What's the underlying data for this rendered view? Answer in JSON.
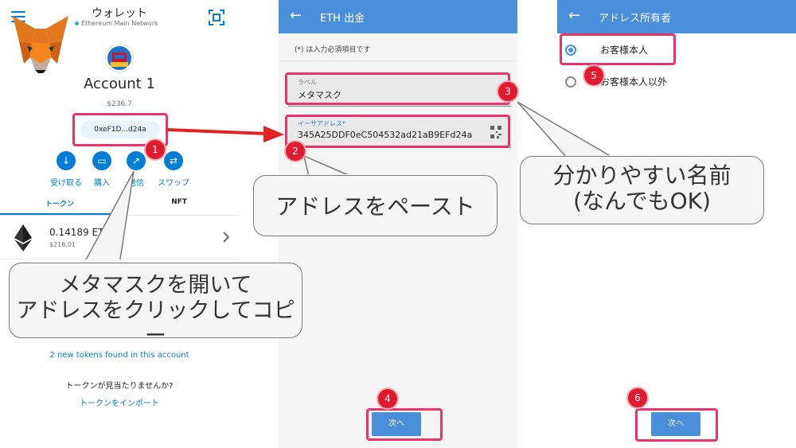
{
  "wallet": {
    "title": "ウォレット",
    "network": "Ethereum Main Network",
    "account_name": "Account 1",
    "balance": "$236.7",
    "address_short": "0xeF1D...d24a",
    "actions": [
      {
        "label": "受け取る",
        "icon": "download-icon"
      },
      {
        "label": "購入",
        "icon": "card-icon"
      },
      {
        "label": "送信",
        "icon": "send-arrow-icon"
      },
      {
        "label": "スワップ",
        "icon": "swap-icon"
      }
    ],
    "tabs": [
      "トークン",
      "NFT"
    ],
    "token": {
      "amount": "0.14189 ETH",
      "fiat": "$216.01"
    },
    "new_tokens_link": "2 new tokens found in this account",
    "no_tokens_text": "トークンが見当たりませんか?",
    "import_tokens_link": "トークンをインポート"
  },
  "withdraw": {
    "title": "ETH 出金",
    "required_note": "(*) は入力必須項目です",
    "label_field": {
      "label": "ラベル",
      "value": "メタマスク"
    },
    "address_field": {
      "label": "イーサアドレス*",
      "value": "345A25DDF0eC504532ad21aB9EFd24a"
    },
    "next_label": "次へ"
  },
  "owner": {
    "title": "アドレス所有者",
    "options": [
      "お客様本人",
      "お客様本人以外"
    ],
    "selected": 0,
    "next_label": "次へ"
  },
  "annotations": {
    "bubble_1": [
      "メタマスクを開いて",
      "アドレスをクリックしてコピー"
    ],
    "bubble_2": "アドレスをペースト",
    "bubble_3": [
      "分かりやすい名前",
      "(なんでもOK)"
    ],
    "badges": [
      "1",
      "2",
      "3",
      "4",
      "5",
      "6"
    ]
  },
  "colors": {
    "accent": "#037dd6",
    "appbar": "#4a8fd9",
    "highlight": "#e8336d",
    "badge": "#e01b2f",
    "arrow": "#e32222"
  }
}
